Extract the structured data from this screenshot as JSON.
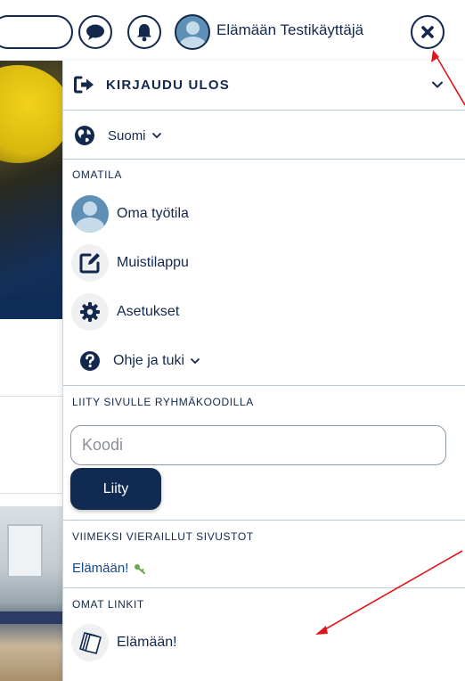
{
  "topbar": {
    "user_name": "Elämään Testikäyttäjä",
    "icons": {
      "chat": "chat-bubble-icon",
      "notifications": "bell-icon",
      "close": "close-x-icon"
    }
  },
  "menu": {
    "logout_label": "KIRJAUDU ULOS",
    "language_label": "Suomi",
    "own_space": {
      "title": "OMATILA",
      "items": [
        {
          "label": "Oma työtila",
          "icon": "avatar-icon"
        },
        {
          "label": "Muistilappu",
          "icon": "edit-note-icon"
        },
        {
          "label": "Asetukset",
          "icon": "gear-icon"
        }
      ]
    },
    "help_label": "Ohje ja tuki",
    "join": {
      "title": "LIITY SIVULLE RYHMÄKOODILLA",
      "placeholder": "Koodi",
      "button_label": "Liity"
    },
    "recent": {
      "title": "VIIMEKSI VIERAILLUT SIVUSTOT",
      "items": [
        {
          "label": "Elämään!",
          "icon": "key-icon"
        }
      ]
    },
    "links": {
      "title": "OMAT LINKIT",
      "items": [
        {
          "label": "Elämään!",
          "icon": "pages-icon"
        }
      ]
    }
  },
  "colors": {
    "navy": "#12284c",
    "button": "#102a52",
    "annotation": "#e0161b",
    "key": "#6aa84f"
  }
}
